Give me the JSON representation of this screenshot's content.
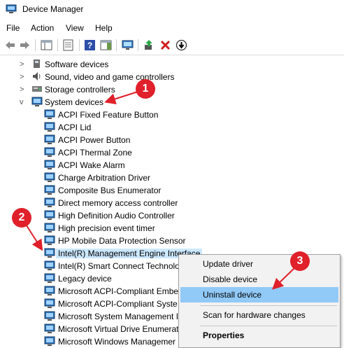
{
  "window": {
    "title": "Device Manager"
  },
  "menu": {
    "file": "File",
    "action": "Action",
    "view": "View",
    "help": "Help"
  },
  "tree": {
    "categories": [
      {
        "label": "Software devices",
        "expand": ">"
      },
      {
        "label": "Sound, video and game controllers",
        "expand": ">"
      },
      {
        "label": "Storage controllers",
        "expand": ">"
      },
      {
        "label": "System devices",
        "expand": "v"
      }
    ],
    "children": [
      "ACPI Fixed Feature Button",
      "ACPI Lid",
      "ACPI Power Button",
      "ACPI Thermal Zone",
      "ACPI Wake Alarm",
      "Charge Arbitration Driver",
      "Composite Bus Enumerator",
      "Direct memory access controller",
      "High Definition Audio Controller",
      "High precision event timer",
      "HP Mobile Data Protection Sensor",
      "Intel(R) Management Engine Interface",
      "Intel(R) Smart Connect Technolo",
      "Legacy device",
      "Microsoft ACPI-Compliant Embe",
      "Microsoft ACPI-Compliant Syste",
      "Microsoft System Management I",
      "Microsoft Virtual Drive Enumerat",
      "Microsoft Windows Managemer"
    ]
  },
  "context_menu": {
    "update": "Update driver",
    "disable": "Disable device",
    "uninstall": "Uninstall device",
    "scan": "Scan for hardware changes",
    "properties": "Properties"
  },
  "annotations": {
    "b1": "1",
    "b2": "2",
    "b3": "3"
  },
  "colors": {
    "badge": "#e0202a",
    "highlight": "#91c9f7",
    "selection": "#cce8ff"
  }
}
